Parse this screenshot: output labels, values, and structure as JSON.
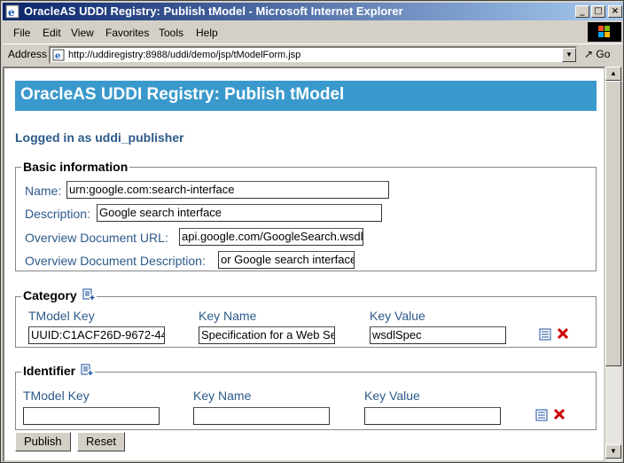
{
  "window": {
    "title": "OracleAS UDDI Registry: Publish tModel - Microsoft Internet Explorer",
    "minimize": "_",
    "maximize": "□",
    "close": "×"
  },
  "menu": {
    "file": "File",
    "edit": "Edit",
    "view": "View",
    "favorites": "Favorites",
    "tools": "Tools",
    "help": "Help"
  },
  "address_bar": {
    "label": "Address",
    "url": "http://uddiregistry:8988/uddi/demo/jsp/tModelForm.jsp",
    "go": "Go"
  },
  "page": {
    "heading": "OracleAS UDDI Registry: Publish tModel",
    "logged_in": "Logged in as uddi_publisher",
    "basic": {
      "legend": "Basic information",
      "name_label": "Name:",
      "name_value": "urn:google.com:search-interface",
      "description_label": "Description:",
      "description_value": "Google search interface",
      "overview_url_label": "Overview Document URL:",
      "overview_url_value": "api.google.com/GoogleSearch.wsdl",
      "overview_desc_label": "Overview Document Description:",
      "overview_desc_value": "or Google search interface"
    },
    "category": {
      "legend": "Category",
      "col_tmodel_key": "TModel Key",
      "col_key_name": "Key Name",
      "col_key_value": "Key Value",
      "row": {
        "tmodel_key": "UUID:C1ACF26D-9672-44",
        "key_name": "Specification for a Web Se",
        "key_value": "wsdlSpec"
      }
    },
    "identifier": {
      "legend": "Identifier",
      "col_tmodel_key": "TModel Key",
      "col_key_name": "Key Name",
      "col_key_value": "Key Value",
      "row": {
        "tmodel_key": "",
        "key_name": "",
        "key_value": ""
      }
    },
    "buttons": {
      "publish": "Publish",
      "reset": "Reset"
    }
  },
  "colors": {
    "title_bar_start": "#0a246a",
    "title_bar_end": "#a6caf0",
    "header_band": "#3a99cc",
    "label_text": "#2c5a8a",
    "delete_icon": "#cc0000"
  },
  "icons": {
    "add": "add-row-icon",
    "details": "details-icon",
    "delete": "delete-icon"
  }
}
